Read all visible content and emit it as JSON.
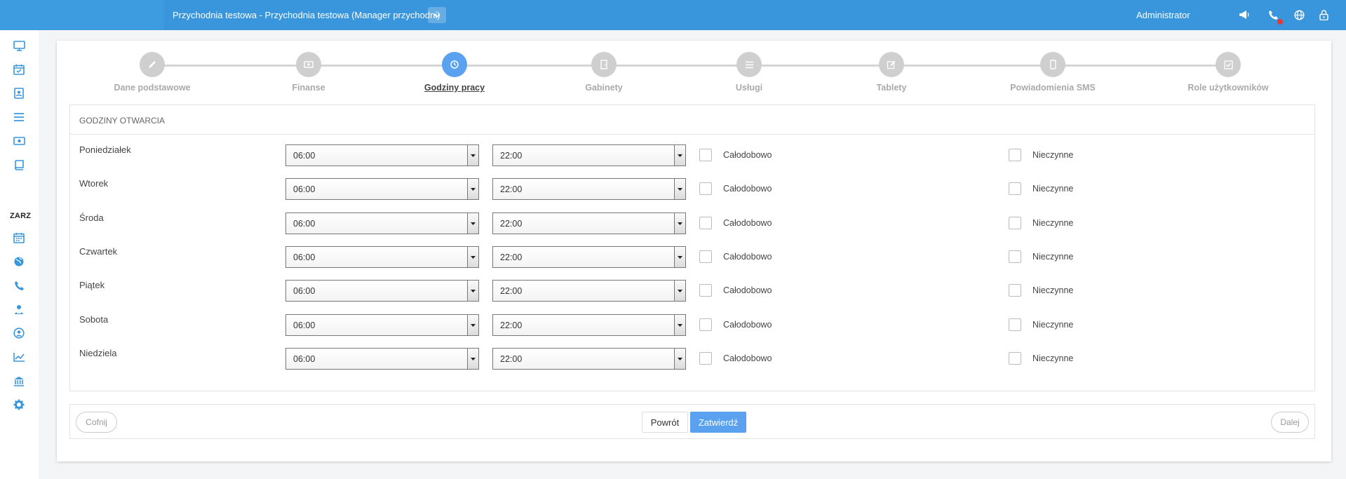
{
  "topbar": {
    "title": "Przychodnia testowa - Przychodnia testowa (Manager przychodni)",
    "user": "Administrator",
    "icons": [
      "megaphone-icon",
      "phone-icon",
      "globe-icon",
      "lock-icon"
    ]
  },
  "sidebar": {
    "section_label": "ZARZ",
    "icons": [
      "monitor-icon",
      "calendar-check-icon",
      "contact-card-icon",
      "list-icon",
      "money-icon",
      "book-icon",
      "calendar-icon",
      "globe-icon",
      "phone-icon",
      "users-icon",
      "user-circle-icon",
      "chart-icon",
      "bank-icon",
      "gear-icon"
    ]
  },
  "wizard": {
    "steps": [
      {
        "label": "Dane podstawowe",
        "icon": "pencil-icon"
      },
      {
        "label": "Finanse",
        "icon": "money-icon"
      },
      {
        "label": "Godziny pracy",
        "icon": "clock-icon"
      },
      {
        "label": "Gabinety",
        "icon": "door-icon"
      },
      {
        "label": "Usługi",
        "icon": "list-icon"
      },
      {
        "label": "Tablety",
        "icon": "edit-icon"
      },
      {
        "label": "Powiadomienia SMS",
        "icon": "mobile-icon"
      },
      {
        "label": "Role użytkowników",
        "icon": "check-square-icon"
      }
    ],
    "active_step": "Godziny pracy"
  },
  "panel": {
    "title": "GODZINY OTWARCIA",
    "allday_label": "Całodobowo",
    "closed_label": "Nieczynne",
    "days": [
      {
        "name": "Poniedziałek",
        "open": "06:00",
        "close": "22:00"
      },
      {
        "name": "Wtorek",
        "open": "06:00",
        "close": "22:00"
      },
      {
        "name": "Środa",
        "open": "06:00",
        "close": "22:00"
      },
      {
        "name": "Czwartek",
        "open": "06:00",
        "close": "22:00"
      },
      {
        "name": "Piątek",
        "open": "06:00",
        "close": "22:00"
      },
      {
        "name": "Sobota",
        "open": "06:00",
        "close": "22:00"
      },
      {
        "name": "Niedziela",
        "open": "06:00",
        "close": "22:00"
      }
    ]
  },
  "footer": {
    "back_label": "Cofnij",
    "return_label": "Powrót",
    "confirm_label": "Zatwierdź",
    "next_label": "Dalej"
  },
  "colors": {
    "topbar": "#3a96dc",
    "accent": "#5aa2ef",
    "sidebar_icon": "#3a96dc"
  }
}
